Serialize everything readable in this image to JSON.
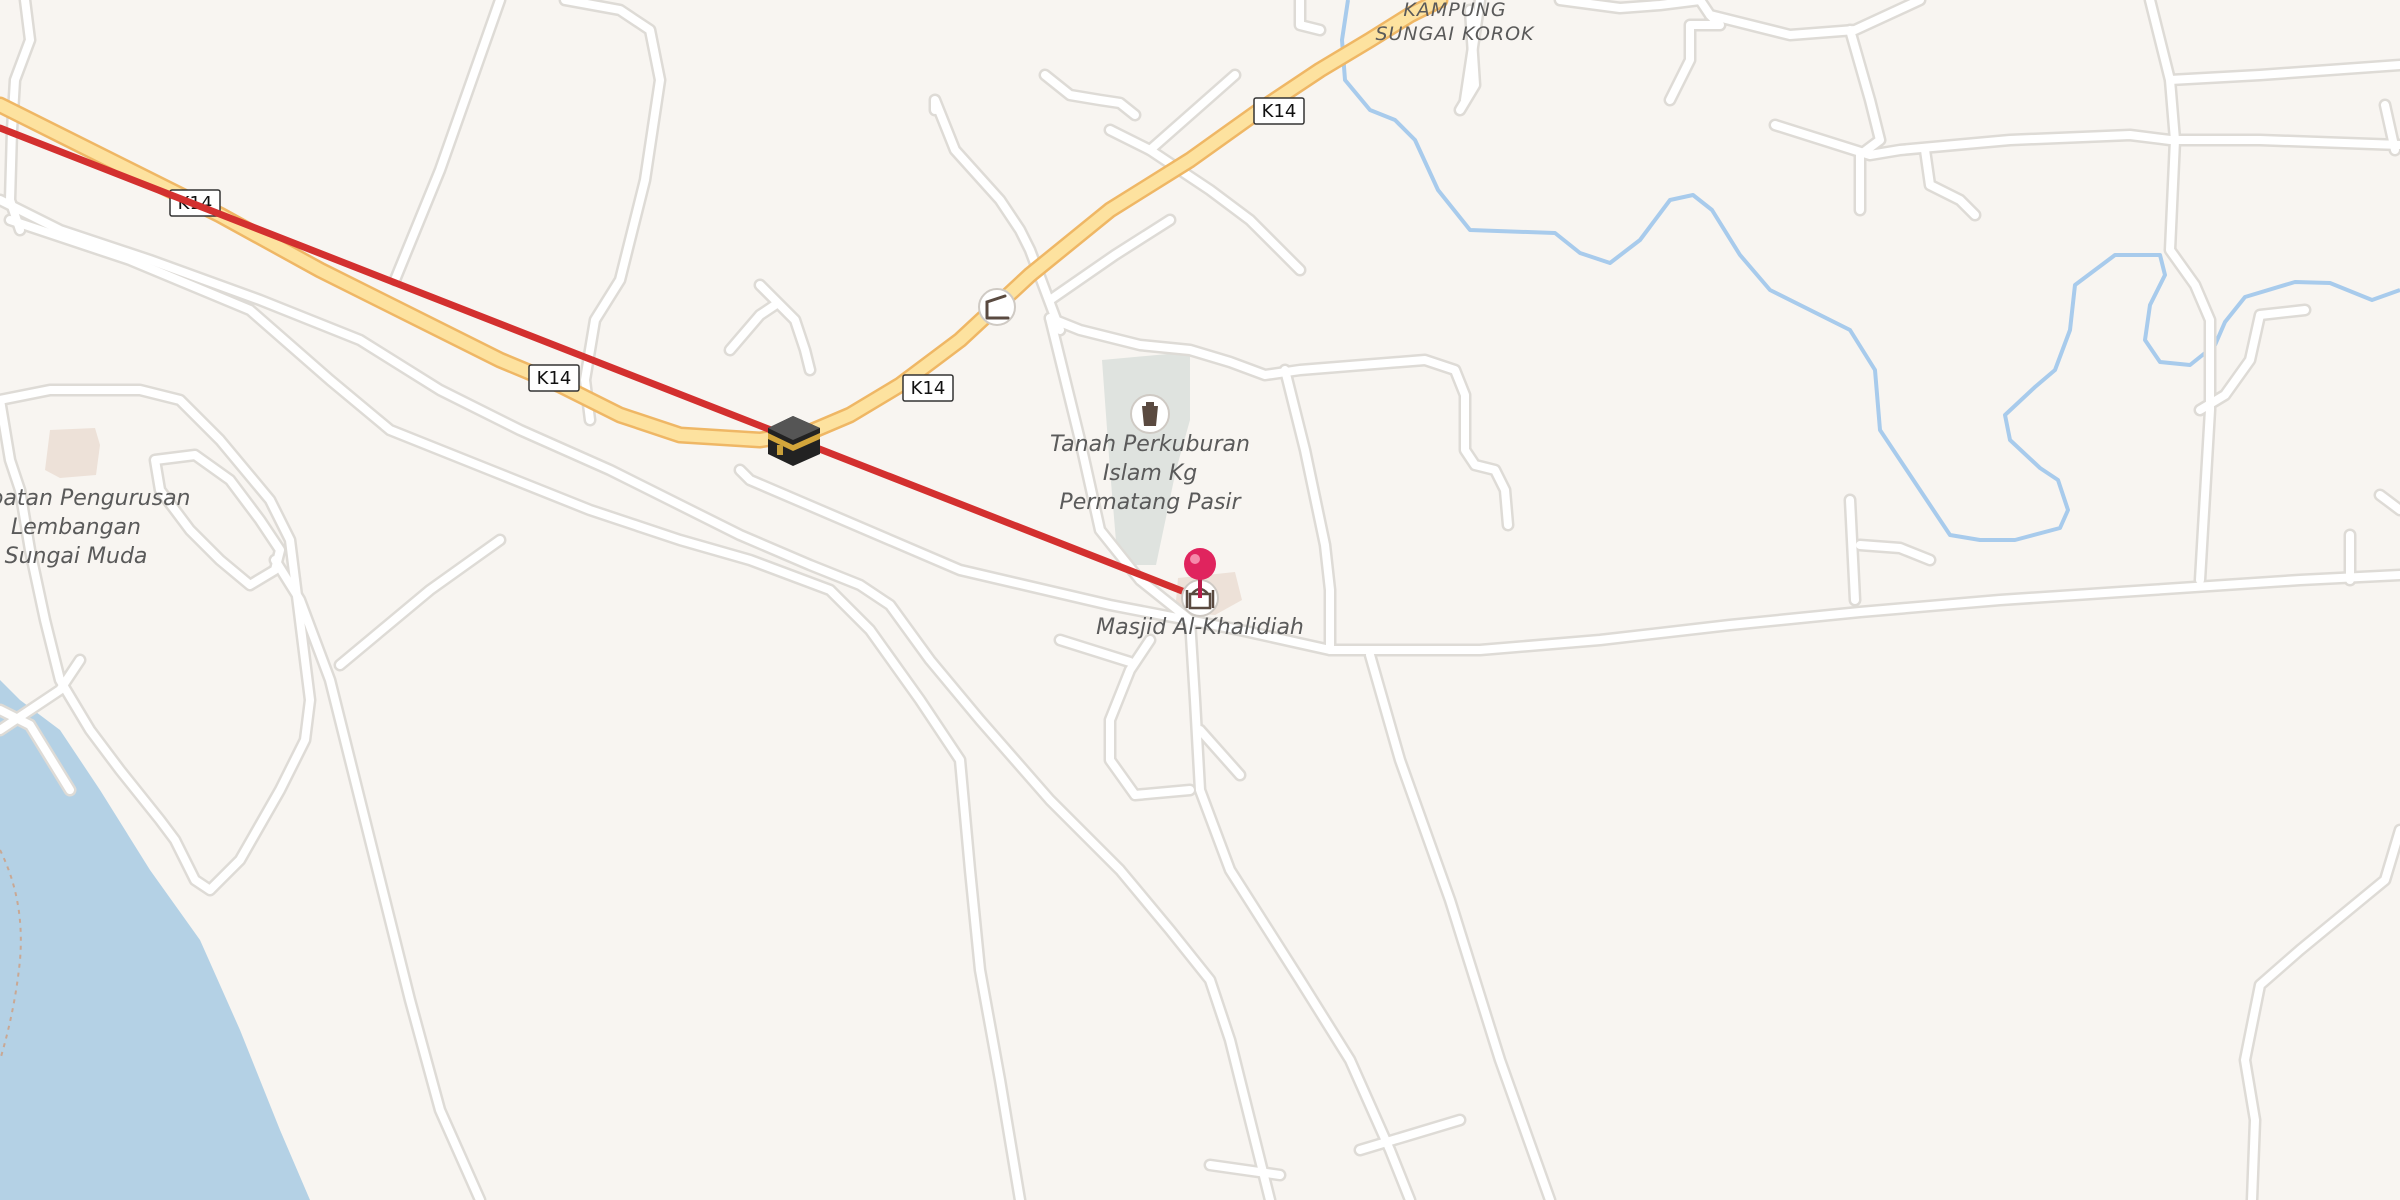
{
  "map": {
    "colors": {
      "land": "#f8f5f1",
      "water": "#b4d1e5",
      "river": "#a8cbec",
      "minor_road": "#ffffff",
      "road_casing": "#dedbd6",
      "main_road": "#fde29f",
      "main_road_casing": "#efb765",
      "cemetery": "#dfe3df",
      "route_line": "#d3302f",
      "pin": "#e0245e"
    },
    "route_shields": [
      "K14",
      "K14",
      "K14",
      "K14"
    ],
    "places": {
      "village": [
        "KAMPUNG",
        "SUNGAI KOROK"
      ],
      "office": [
        "Jabatan Pengurusan",
        "Lembangan",
        "Sungai Muda"
      ],
      "cemetery": [
        "Tanah Perkuburan",
        "Islam Kg",
        "Permatang Pasir"
      ],
      "mosque": "Masjid Al-Khalidiah"
    },
    "icons": {
      "qibla_marker": "kaaba-icon",
      "destination": "map-pin-icon",
      "mosque": "mosque-icon",
      "cemetery": "cemetery-icon",
      "poi": "shelter-icon"
    }
  }
}
